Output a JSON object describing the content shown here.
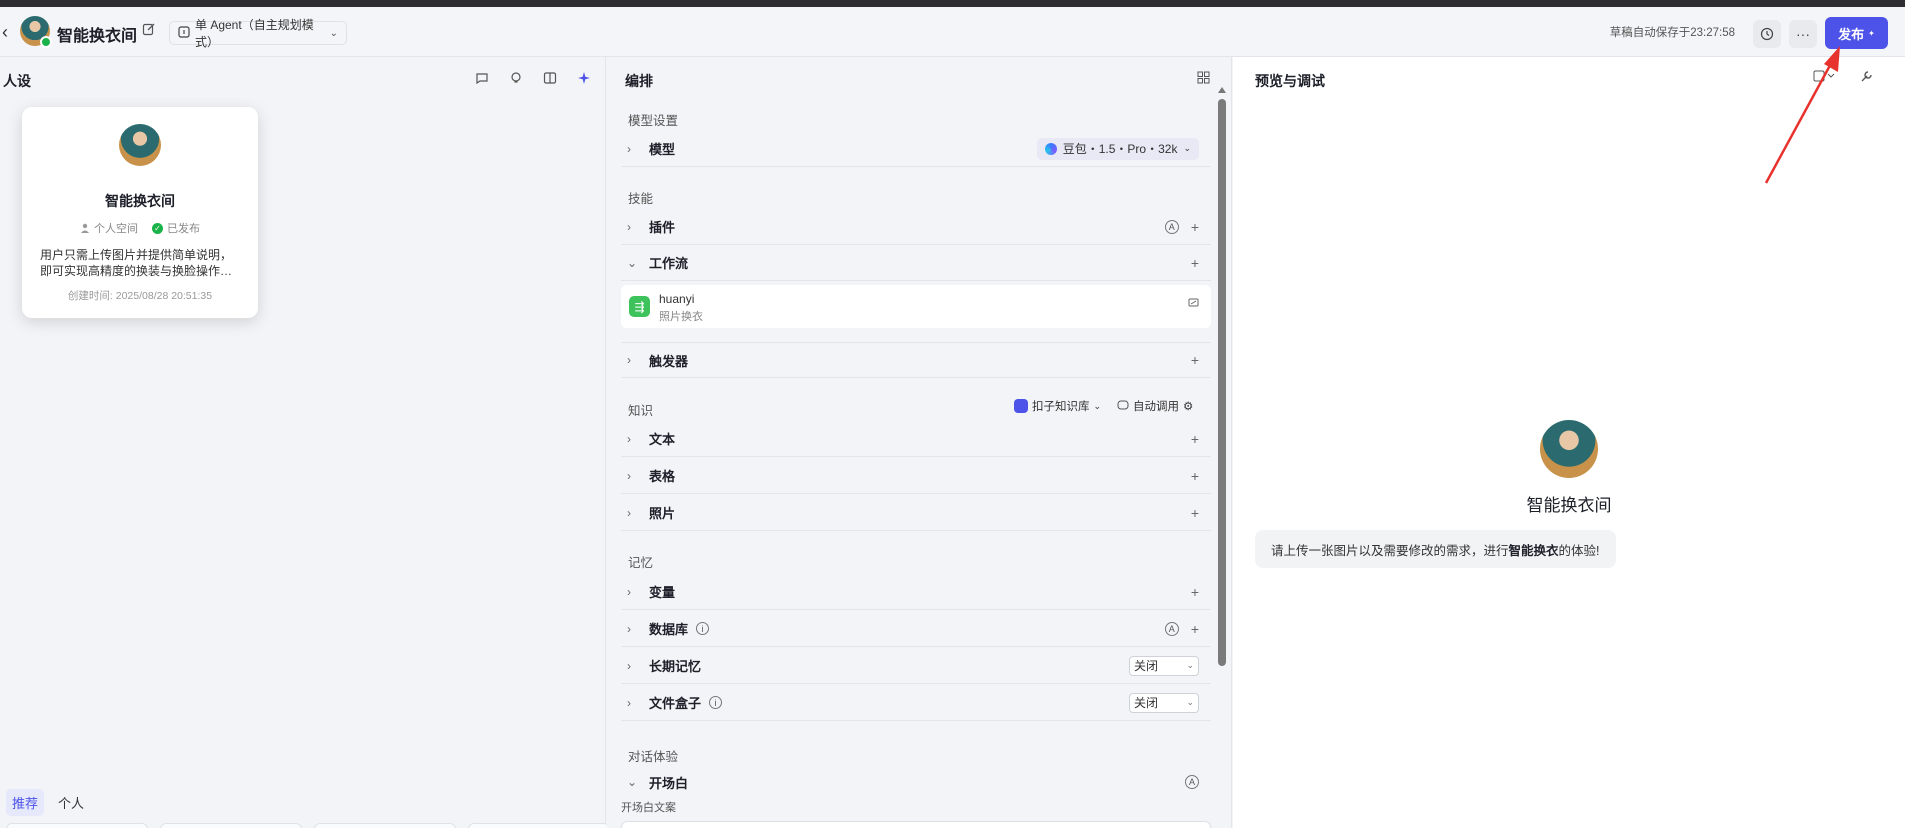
{
  "header": {
    "title": "智能换衣间",
    "agent_mode": "单 Agent（自主规划模式）",
    "autosave": "草稿自动保存于23:27:58",
    "publish_label": "发布"
  },
  "left": {
    "title": "人设",
    "tabs": [
      "推荐",
      "个人"
    ]
  },
  "popup": {
    "name": "智能换衣间",
    "space": "个人空间",
    "status": "已发布",
    "description": "用户只需上传图片并提供简单说明，即可实现高精度的换装与换脸操作…",
    "created": "创建时间: 2025/08/28 20:51:35"
  },
  "middle": {
    "title": "编排",
    "sections": {
      "model_settings": "模型设置",
      "skills": "技能",
      "knowledge": "知识",
      "memory": "记忆",
      "conversation": "对话体验"
    },
    "rows": {
      "model": "模型",
      "plugins": "插件",
      "workflow": "工作流",
      "triggers": "触发器",
      "text": "文本",
      "table": "表格",
      "photos": "照片",
      "variables": "变量",
      "database": "数据库",
      "long_memory": "长期记忆",
      "file_box": "文件盒子",
      "opening": "开场白"
    },
    "model_pill": "豆包・1.5・Pro・32k",
    "workflow_item": {
      "name": "huanyi",
      "desc": "照片换衣"
    },
    "kb_source": "扣子知识库",
    "auto_call": "自动调用",
    "long_memory_value": "关闭",
    "file_box_value": "关闭",
    "opening_text_label": "开场白文案"
  },
  "right": {
    "title": "预览与调试",
    "bot_name": "智能换衣间",
    "welcome_prefix": "请上传一张图片以及需要修改的需求，进行",
    "welcome_bold": "智能换衣",
    "welcome_suffix": "的体验!"
  },
  "colors": {
    "accent": "#4d53e8",
    "success": "#19b34a",
    "annotation_arrow": "#e8322e"
  }
}
